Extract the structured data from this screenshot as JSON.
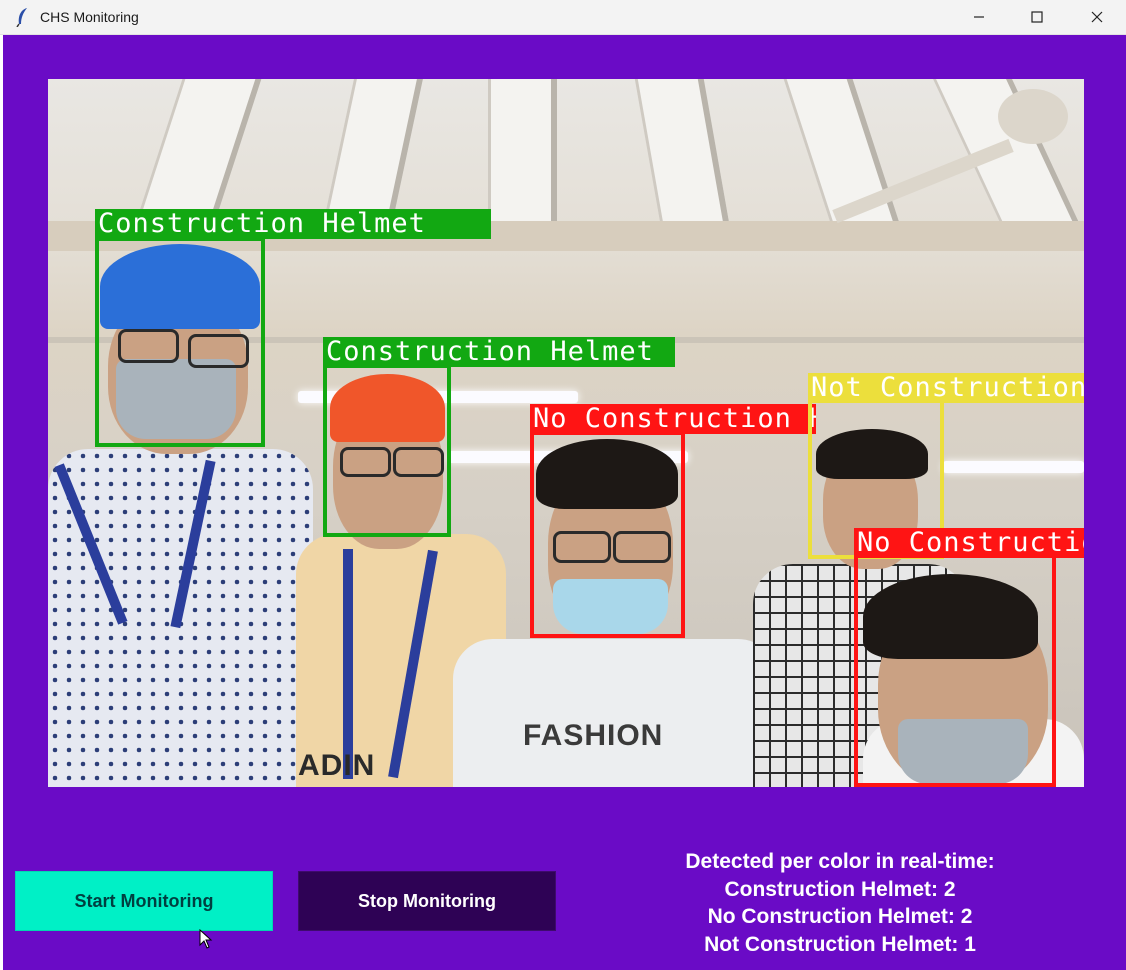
{
  "window": {
    "title": "CHS Monitoring",
    "icon": "feather-icon",
    "controls": [
      "minimize-icon",
      "maximize-icon",
      "close-icon"
    ]
  },
  "colors": {
    "background": "#6a0bc6",
    "start_button": "#00f0c6",
    "stop_button": "#2e0255",
    "helmet_box": "#12a812",
    "no_helmet_box": "#ff1414",
    "not_helmet_box": "#ecdf3c"
  },
  "detections": [
    {
      "label": "Construction Helmet",
      "status": "helmet"
    },
    {
      "label": "Construction Helmet",
      "status": "helmet"
    },
    {
      "label": "No Construction Helmet",
      "status": "no_helmet"
    },
    {
      "label": "Not Construction Helmet",
      "status": "not_helmet"
    },
    {
      "label": "No Construction Helmet",
      "status": "no_helmet"
    }
  ],
  "scene": {
    "hoodie_text": "FASHION",
    "shirt_text": "ADIN"
  },
  "controls": {
    "start_label": "Start Monitoring",
    "stop_label": "Stop Monitoring"
  },
  "stats": {
    "heading": "Detected per color in real-time:",
    "lines": [
      "Construction Helmet: 2",
      "No Construction Helmet: 2",
      "Not Construction Helmet: 1"
    ]
  }
}
